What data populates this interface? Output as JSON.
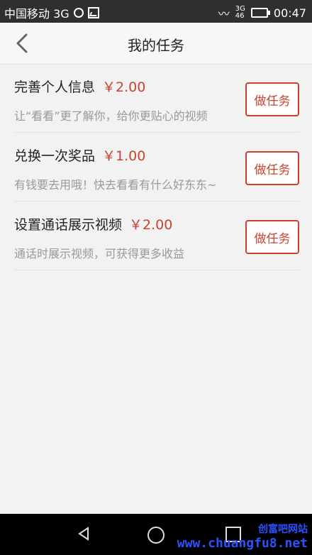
{
  "status_bar": {
    "carrier": "中国移动 3G",
    "time": "00:47",
    "signal_top": "3G",
    "signal_bottom": "46"
  },
  "nav": {
    "title": "我的任务"
  },
  "tasks": [
    {
      "title": "完善个人信息",
      "price": "￥2.00",
      "desc": "让“看看”更了解你，给你更贴心的视频",
      "button": "做任务"
    },
    {
      "title": "兑换一次奖品",
      "price": "￥1.00",
      "desc": "有钱要去用哦！快去看看有什么好东东~",
      "button": "做任务"
    },
    {
      "title": "设置通话展示视频",
      "price": "￥2.00",
      "desc": "通话时展示视频，可获得更多收益",
      "button": "做任务"
    }
  ],
  "watermark": {
    "line1": "创富吧网站",
    "line2": "www.chuangfu8.net"
  },
  "colors": {
    "accent": "#c8432f"
  }
}
